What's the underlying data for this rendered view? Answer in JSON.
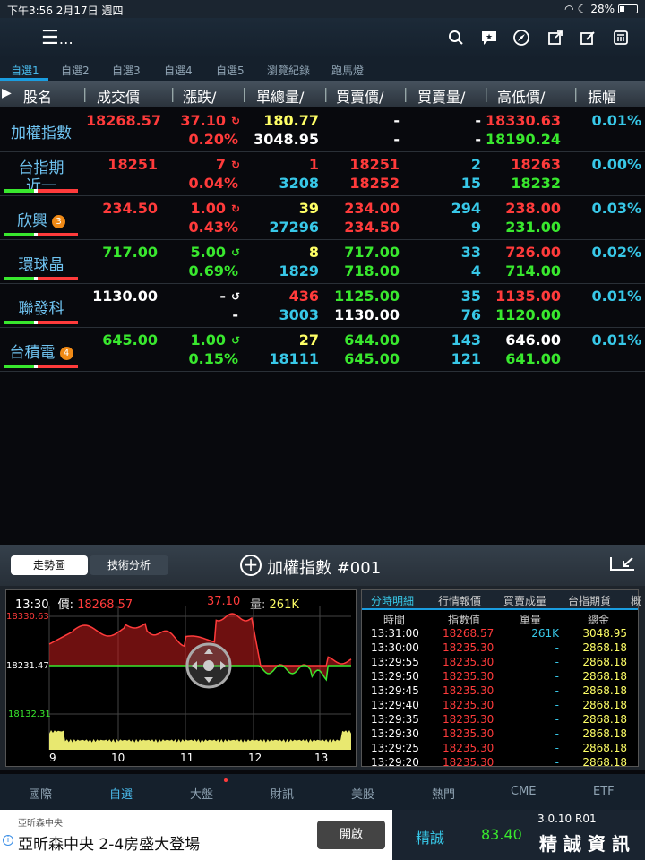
{
  "status": {
    "time": "下午3:56",
    "date": "2月17日 週四",
    "battery": "28%"
  },
  "tabs": [
    "自選1",
    "自選2",
    "自選3",
    "自選4",
    "自選5",
    "瀏覽紀錄",
    "跑馬燈"
  ],
  "headers": [
    "股名",
    "成交價",
    "漲跌/",
    "單總量/",
    "買賣價/",
    "買賣量/",
    "高低價/",
    "振幅"
  ],
  "rows": [
    {
      "name": "加權指數",
      "price": "18268.57",
      "chg1": "37.10",
      "chg2": "0.20%",
      "vol1": "180.77",
      "vol2": "3048.95",
      "bs1": "-",
      "bs2": "-",
      "bq1": "-",
      "bq2": "-",
      "hl1": "18330.63",
      "hl2": "18190.24",
      "amp": "0.01%",
      "pc": "red",
      "c1": "red",
      "c2": "red",
      "v1c": "yel",
      "v2c": "wht",
      "b1c": "wht",
      "b2c": "wht",
      "q1c": "wht",
      "q2c": "wht",
      "h1c": "red",
      "h2c": "grn",
      "arrow": "↻",
      "badge": ""
    },
    {
      "name": "台指期",
      "name2": "近一",
      "price": "18251",
      "chg1": "7",
      "chg2": "0.04%",
      "vol1": "1",
      "vol2": "3208",
      "bs1": "18251",
      "bs2": "18252",
      "bq1": "2",
      "bq2": "15",
      "hl1": "18263",
      "hl2": "18232",
      "amp": "0.00%",
      "pc": "red",
      "c1": "red",
      "c2": "red",
      "v1c": "red",
      "v2c": "cyn",
      "b1c": "red",
      "b2c": "red",
      "q1c": "cyn",
      "q2c": "cyn",
      "h1c": "red",
      "h2c": "grn",
      "arrow": "↻",
      "badge": ""
    },
    {
      "name": "欣興",
      "price": "234.50",
      "chg1": "1.00",
      "chg2": "0.43%",
      "vol1": "39",
      "vol2": "27296",
      "bs1": "234.00",
      "bs2": "234.50",
      "bq1": "294",
      "bq2": "9",
      "hl1": "238.00",
      "hl2": "231.00",
      "amp": "0.03%",
      "pc": "red",
      "c1": "red",
      "c2": "red",
      "v1c": "yel",
      "v2c": "cyn",
      "b1c": "red",
      "b2c": "red",
      "q1c": "cyn",
      "q2c": "cyn",
      "h1c": "red",
      "h2c": "grn",
      "arrow": "↻",
      "badge": "3"
    },
    {
      "name": "環球晶",
      "price": "717.00",
      "chg1": "5.00",
      "chg2": "0.69%",
      "vol1": "8",
      "vol2": "1829",
      "bs1": "717.00",
      "bs2": "718.00",
      "bq1": "33",
      "bq2": "4",
      "hl1": "726.00",
      "hl2": "714.00",
      "amp": "0.02%",
      "pc": "grn",
      "c1": "grn",
      "c2": "grn",
      "v1c": "yel",
      "v2c": "cyn",
      "b1c": "grn",
      "b2c": "grn",
      "q1c": "cyn",
      "q2c": "cyn",
      "h1c": "red",
      "h2c": "grn",
      "arrow": "↺",
      "badge": ""
    },
    {
      "name": "聯發科",
      "price": "1130.00",
      "chg1": "-",
      "chg2": "-",
      "vol1": "436",
      "vol2": "3003",
      "bs1": "1125.00",
      "bs2": "1130.00",
      "bq1": "35",
      "bq2": "76",
      "hl1": "1135.00",
      "hl2": "1120.00",
      "amp": "0.01%",
      "pc": "wht",
      "c1": "wht",
      "c2": "wht",
      "v1c": "red",
      "v2c": "cyn",
      "b1c": "grn",
      "b2c": "wht",
      "q1c": "cyn",
      "q2c": "cyn",
      "h1c": "red",
      "h2c": "grn",
      "arrow": "↺",
      "badge": ""
    },
    {
      "name": "台積電",
      "price": "645.00",
      "chg1": "1.00",
      "chg2": "0.15%",
      "vol1": "27",
      "vol2": "18111",
      "bs1": "644.00",
      "bs2": "645.00",
      "bq1": "143",
      "bq2": "121",
      "hl1": "646.00",
      "hl2": "641.00",
      "amp": "0.01%",
      "pc": "grn",
      "c1": "grn",
      "c2": "grn",
      "v1c": "yel",
      "v2c": "cyn",
      "b1c": "grn",
      "b2c": "grn",
      "q1c": "cyn",
      "q2c": "cyn",
      "h1c": "wht",
      "h2c": "grn",
      "arrow": "↺",
      "badge": "4"
    }
  ],
  "panel": {
    "seg1": "走勢圖",
    "seg2": "技術分析",
    "title": "加權指數 #001"
  },
  "chart": {
    "time": "13:30",
    "price_label": "價:",
    "price": "18268.57",
    "chg": "37.10",
    "vol_label": "量:",
    "vol": "261K",
    "y_hi": "18330.63",
    "y_mid": "18231.47",
    "y_lo": "18132.31",
    "xticks": [
      "9",
      "10",
      "11",
      "12",
      "13"
    ]
  },
  "detail": {
    "tabs": [
      "分時明細",
      "行情報價",
      "買賣成量",
      "台指期貨",
      "概"
    ],
    "cols": [
      "時間",
      "指數值",
      "單量",
      "總金"
    ],
    "rows": [
      [
        "13:31:00",
        "18268.57",
        "261K",
        "3048.95"
      ],
      [
        "13:30:00",
        "18235.30",
        "-",
        "2868.18"
      ],
      [
        "13:29:55",
        "18235.30",
        "-",
        "2868.18"
      ],
      [
        "13:29:50",
        "18235.30",
        "-",
        "2868.18"
      ],
      [
        "13:29:45",
        "18235.30",
        "-",
        "2868.18"
      ],
      [
        "13:29:40",
        "18235.30",
        "-",
        "2868.18"
      ],
      [
        "13:29:35",
        "18235.30",
        "-",
        "2868.18"
      ],
      [
        "13:29:30",
        "18235.30",
        "-",
        "2868.18"
      ],
      [
        "13:29:25",
        "18235.30",
        "-",
        "2868.18"
      ],
      [
        "13:29:20",
        "18235.30",
        "-",
        "2868.18"
      ]
    ]
  },
  "nav": [
    "國際",
    "自選",
    "大盤",
    "財訊",
    "美股",
    "熱門",
    "CME",
    "ETF"
  ],
  "ad": {
    "sponsor": "亞昕森中央",
    "text": "亞昕森中央 2-4房盛大登場",
    "button": "開啟"
  },
  "quote": {
    "name": "精誠",
    "price": "83.40",
    "version": "3.0.10 R01",
    "brand": "精 誠 資 訊"
  },
  "colors": {
    "red": "#ff3b3b",
    "green": "#39e82e",
    "yellow": "#ffff66",
    "cyan": "#38c8e8",
    "accent": "#1a9de0"
  }
}
